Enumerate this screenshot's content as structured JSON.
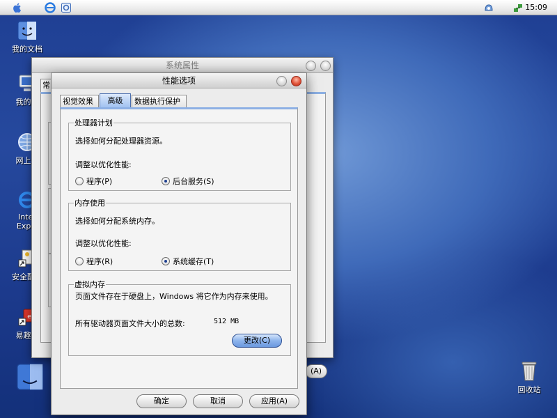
{
  "menubar": {
    "clock": "15:09"
  },
  "desktop": {
    "icons": [
      {
        "label": "我的文档"
      },
      {
        "label": "我的电"
      },
      {
        "label": "网上邻"
      },
      {
        "label": "Inter\nExplo"
      },
      {
        "label": "安全配置"
      },
      {
        "label": "易趣网"
      }
    ],
    "trash": "回收站"
  },
  "back_window": {
    "title": "系统属性",
    "tab_fragment": "常",
    "apply_fragment": "(A)"
  },
  "perf_window": {
    "title": "性能选项",
    "tabs": [
      "视觉效果",
      "高级",
      "数据执行保护"
    ],
    "processor": {
      "legend": "处理器计划",
      "desc": "选择如何分配处理器资源。",
      "adjust": "调整以优化性能:",
      "opt_program": "程序(P)",
      "opt_service": "后台服务(S)"
    },
    "memory": {
      "legend": "内存使用",
      "desc": "选择如何分配系统内存。",
      "adjust": "调整以优化性能:",
      "opt_program": "程序(R)",
      "opt_cache": "系统缓存(T)"
    },
    "virtual": {
      "legend": "虚拟内存",
      "desc": "页面文件存在于硬盘上，Windows 将它作为内存来使用。",
      "total_label": "所有驱动器页面文件大小的总数:",
      "total_value": "512 MB",
      "change_button": "更改(C)"
    },
    "buttons": {
      "ok": "确定",
      "cancel": "取消",
      "apply": "应用(A)"
    }
  }
}
